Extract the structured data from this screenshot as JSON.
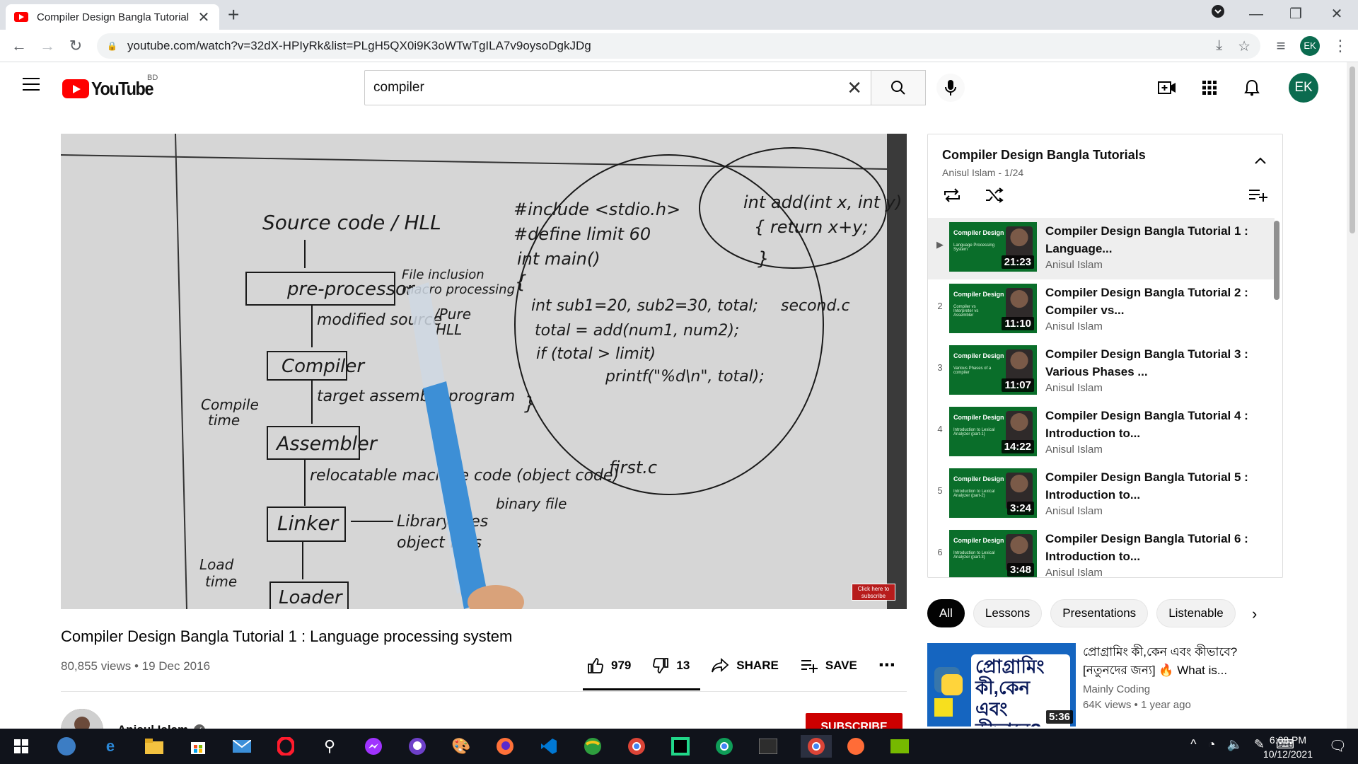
{
  "browser": {
    "tab_title": "Compiler Design Bangla Tutorial",
    "tab_close": "✕",
    "new_tab": "+",
    "url": "youtube.com/watch?v=32dX-HPIyRk&list=PLgH5QX0i9K3oWTwTgILA7v9oysoDgkJDg",
    "profile_initials": "EK"
  },
  "header": {
    "logo_text": "YouTube",
    "country_code": "BD",
    "search_query": "compiler",
    "avatar_initials": "EK"
  },
  "video": {
    "title": "Compiler Design Bangla Tutorial 1 : Language processing system",
    "views": "80,855 views",
    "date": "19 Dec 2016",
    "meta_sep": " • ",
    "likes": "979",
    "dislikes": "13",
    "share_label": "SHARE",
    "save_label": "SAVE",
    "more": "⋯",
    "cta_text": "Click here to subscribe"
  },
  "channel": {
    "name": "Anisul Islam",
    "subscribe_label": "SUBSCRIBE"
  },
  "playlist": {
    "title": "Compiler Design Bangla Tutorials",
    "subtitle": "Anisul Islam - 1/24",
    "items": [
      {
        "index": "▶",
        "thumb_label": "Compiler Design",
        "thumb_sub": "Language Processing System",
        "duration": "21:23",
        "title": "Compiler Design Bangla Tutorial 1 : Language...",
        "channel": "Anisul Islam"
      },
      {
        "index": "2",
        "thumb_label": "Compiler Design",
        "thumb_sub": "Compiler vs Interpreter vs Assembler",
        "duration": "11:10",
        "title": "Compiler Design Bangla Tutorial 2 : Compiler vs...",
        "channel": "Anisul Islam"
      },
      {
        "index": "3",
        "thumb_label": "Compiler Design",
        "thumb_sub": "Various Phases of a compiler",
        "duration": "11:07",
        "title": "Compiler Design Bangla Tutorial 3 : Various Phases ...",
        "channel": "Anisul Islam"
      },
      {
        "index": "4",
        "thumb_label": "Compiler Design",
        "thumb_sub": "Introduction to Lexical Analyzer (part-1)",
        "duration": "14:22",
        "title": "Compiler Design Bangla Tutorial 4 : Introduction to...",
        "channel": "Anisul Islam"
      },
      {
        "index": "5",
        "thumb_label": "Compiler Design",
        "thumb_sub": "Introduction to Lexical Analyzer (part-2)",
        "duration": "3:24",
        "title": "Compiler Design Bangla Tutorial 5 : Introduction to...",
        "channel": "Anisul Islam"
      },
      {
        "index": "6",
        "thumb_label": "Compiler Design",
        "thumb_sub": "Introduction to Lexical Analyzer (part-3)",
        "duration": "3:48",
        "title": "Compiler Design Bangla Tutorial 6 : Introduction to...",
        "channel": "Anisul Islam"
      }
    ]
  },
  "chips": [
    "All",
    "Lessons",
    "Presentations",
    "Listenable"
  ],
  "recommended": {
    "thumb_text": "প্রোগ্রামিং কী,কেন এবং কীভাবে?",
    "duration": "5:36",
    "title": "প্রোগ্রামিং কী,কেন এবং কীভাবে? [নতুনদের জন্য] 🔥 What is...",
    "channel": "Mainly Coding",
    "meta": "64K views • 1 year ago"
  },
  "whiteboard": {
    "lines": [
      "Source code / HLL",
      "pre-processor",
      "File inclusion",
      "macro processing",
      "modified source",
      "/Pure",
      "HLL",
      "Compiler",
      "target assembly program",
      "Compile",
      "time",
      "Assembler",
      "relocatable machine code (object code)",
      "binary file",
      "Linker",
      "Library files",
      "object files",
      "Load",
      "time",
      "Loader",
      "#include <stdio.h>",
      "#define limit 60",
      "int main()",
      "{",
      "int sub1=20, sub2=30, total;",
      "total = add(num1, num2);",
      "if (total > limit)",
      "printf(\"%d\\n\", total);",
      "}",
      "first.c",
      "int add(int x, int y)",
      "{ return x+y;",
      "}",
      "second.c"
    ]
  },
  "taskbar": {
    "time": "6:08 PM",
    "date": "10/12/2021"
  },
  "colors": {
    "brand_red": "#ff0000",
    "subscribe_red": "#cc0000",
    "avatar_green": "#0b6b4f",
    "thumb_green": "#0a6e2a"
  }
}
